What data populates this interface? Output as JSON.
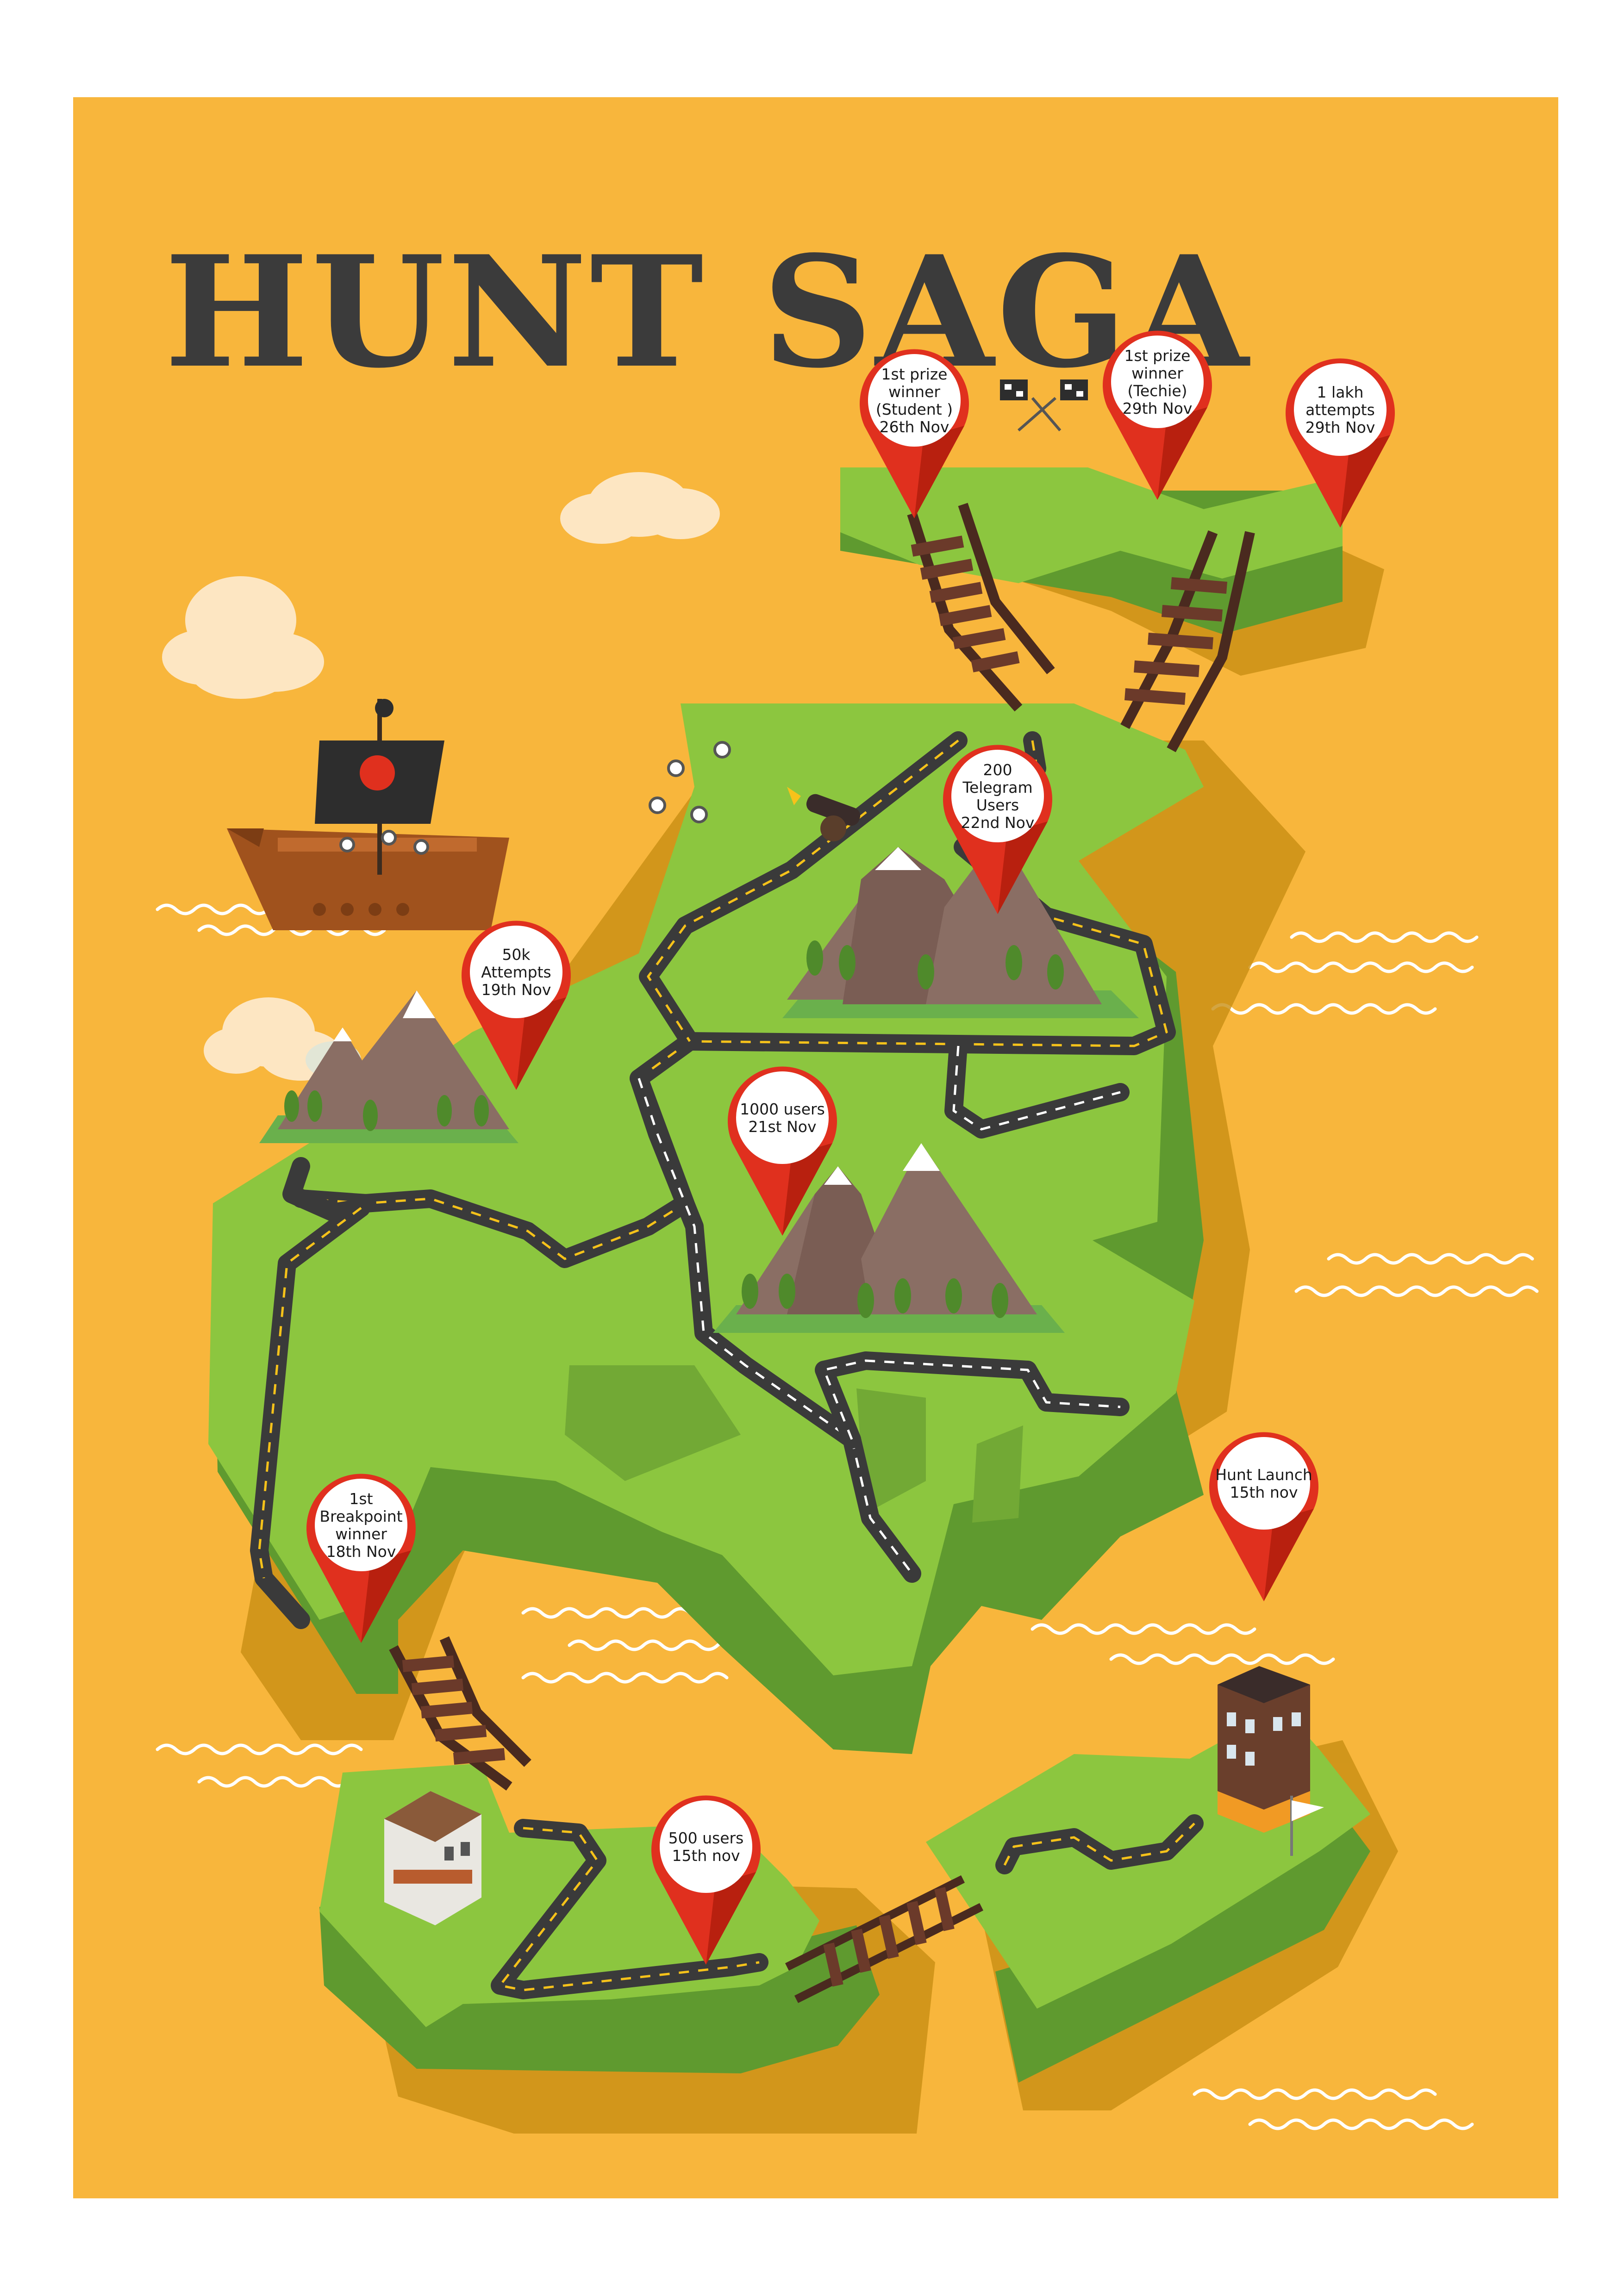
{
  "poster": {
    "title": "HUNT SAGA",
    "colors": {
      "background": "#f8b63c",
      "frame": "#ffffff",
      "land_top": "#8cc63f",
      "land_side": "#5f9a2f",
      "shadow": "#c88f13",
      "road": "#3a3a3a",
      "pin": "#e0301e"
    }
  },
  "milestones": [
    {
      "name": "hunt-launch",
      "lines": [
        "Hunt Launch",
        "15th nov"
      ]
    },
    {
      "name": "500-users",
      "lines": [
        "500 users",
        "15th nov"
      ]
    },
    {
      "name": "1st-breakpoint-winner",
      "lines": [
        "1st",
        "Breakpoint",
        "winner",
        "18th Nov"
      ]
    },
    {
      "name": "50k-attempts",
      "lines": [
        "50k",
        "Attempts",
        "19th Nov"
      ]
    },
    {
      "name": "1000-users",
      "lines": [
        "1000 users",
        "21st Nov"
      ]
    },
    {
      "name": "200-telegram-users",
      "lines": [
        "200",
        "Telegram",
        "Users",
        "22nd Nov"
      ]
    },
    {
      "name": "1st-prize-winner-student",
      "lines": [
        "1st prize",
        "winner",
        "(Student )",
        "26th Nov"
      ]
    },
    {
      "name": "1st-prize-winner-techie",
      "lines": [
        "1st prize",
        "winner",
        "(Techie)",
        "29th Nov"
      ]
    },
    {
      "name": "1-lakh-attempts",
      "lines": [
        "1 lakh",
        "attempts",
        "29th Nov"
      ]
    }
  ],
  "decorations": {
    "icons": [
      "pirate-ship-icon",
      "skull-flag-icon",
      "cannon-icon",
      "skeleton-icon",
      "checkered-flags-icon",
      "mountain-icon",
      "cloud-icon",
      "building-icon",
      "house-icon",
      "finish-flag-icon",
      "rope-bridge-icon"
    ]
  }
}
